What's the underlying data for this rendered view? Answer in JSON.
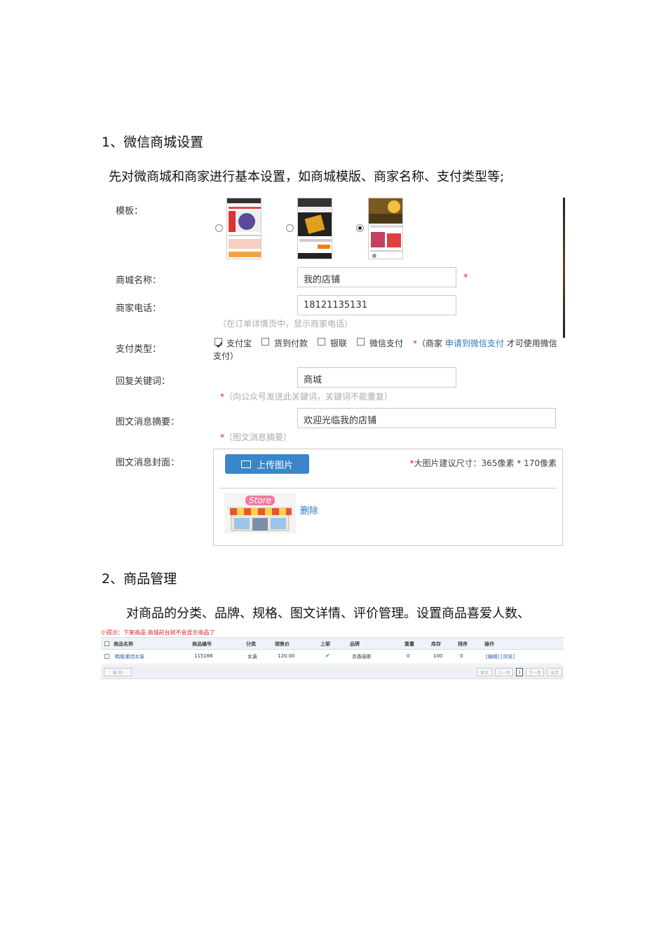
{
  "section1": {
    "heading": "1、微信商城设置",
    "intro": "先对微商城和商家进行基本设置，如商城模版、商家名称、支付类型等;"
  },
  "form": {
    "template_label": "模板：",
    "shop_name_label": "商城名称：",
    "shop_name_value": "我的店铺",
    "required_mark": "*",
    "phone_label": "商家电话：",
    "phone_value": "18121135131",
    "phone_hint": "（在订单详情页中，显示商家电话）",
    "payment_label": "支付类型：",
    "payment_options": [
      "支付宝",
      "货到付款",
      "银联",
      "微信支付"
    ],
    "payment_note_prefix": "（商家",
    "payment_note_link": "申请到微信支付",
    "payment_note_suffix": "才可使用微信",
    "payment_note_wrap": "支付）",
    "keyword_label": "回复关键词：",
    "keyword_value": "商城",
    "keyword_hint": "（向公众号发送此关键词，关键词不能重复）",
    "summary_label": "图文消息摘要：",
    "summary_value": "欢迎光临我的店铺",
    "summary_hint": "（图文消息摘要）",
    "cover_label": "图文消息封面：",
    "upload_button": "上传图片",
    "size_note": "大图片建议尺寸：365像素 * 170像素",
    "store_sign": "Store",
    "delete_link": "删除"
  },
  "section2": {
    "heading": "2、商品管理",
    "intro": "对商品的分类、品牌、规格、图文详情、评价管理。设置商品喜爱人数、"
  },
  "product_table": {
    "tip": "小提示：下架商品 商城前台就不会显示商品了",
    "headers": [
      "商品名称",
      "商品编号",
      "分类",
      "销售价",
      "上架",
      "品牌",
      "重量",
      "库存",
      "排序",
      "操作"
    ],
    "row": {
      "name": "韩版潮流女装",
      "code": "115166",
      "category": "女装",
      "price": "120.00",
      "brand": "衣香丽影",
      "weight": "0",
      "stock": "100",
      "sort": "0",
      "actions": "[编辑] [浏览]"
    },
    "delete_button": "删 除",
    "pagination": [
      "首页",
      "上一页",
      "1",
      "下一页",
      "末页"
    ]
  }
}
